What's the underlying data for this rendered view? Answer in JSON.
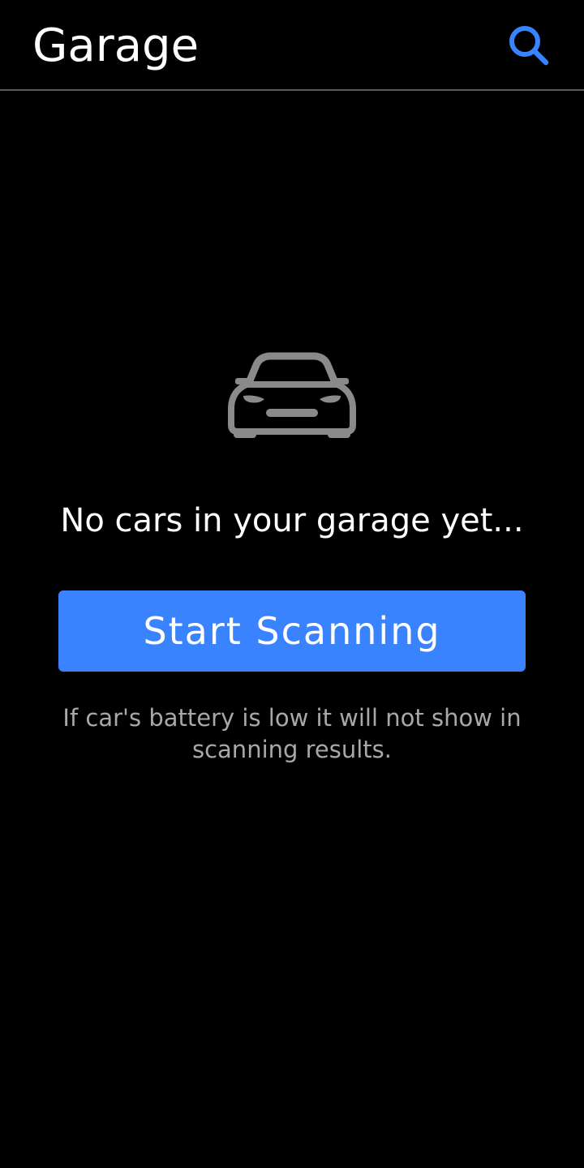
{
  "header": {
    "title": "Garage",
    "search_icon": "search-icon",
    "accent_color": "#3a83ff"
  },
  "empty_state": {
    "icon": "car-icon",
    "icon_color": "#8a8a8a",
    "message": "No cars in your garage yet...",
    "scan_button_label": "Start Scanning",
    "note": "If car's battery is low it will not show in scanning results."
  },
  "colors": {
    "background": "#000000",
    "divider": "#5a5a5a",
    "button": "#3a83ff",
    "note_text": "#a8a8a8"
  }
}
